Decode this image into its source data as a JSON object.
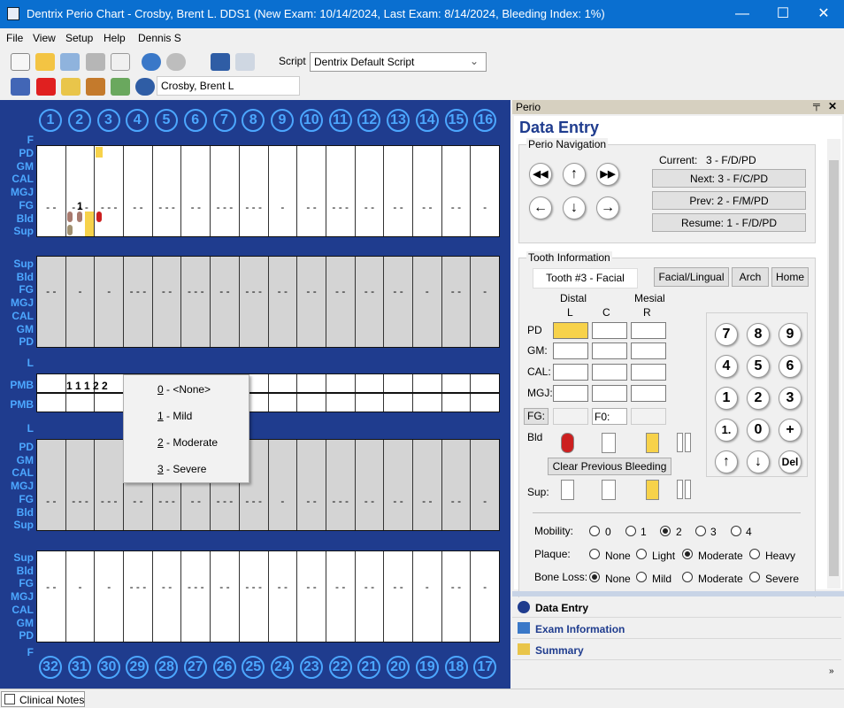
{
  "window": {
    "title": "Dentrix Perio Chart - Crosby, Brent L.  DDS1 (New Exam: 10/14/2024, Last Exam: 8/14/2024, Bleeding Index: 1%)",
    "minimize": "—",
    "maximize": "☐",
    "close": "✕"
  },
  "menu": [
    "File",
    "View",
    "Setup",
    "Help",
    "Dennis S"
  ],
  "toolbar": {
    "script_label": "Script",
    "script_value": "Dentrix Default Script",
    "patient": "Crosby, Brent L"
  },
  "chart": {
    "upper_teeth": [
      "1",
      "2",
      "3",
      "4",
      "5",
      "6",
      "7",
      "8",
      "9",
      "10",
      "11",
      "12",
      "13",
      "14",
      "15",
      "16"
    ],
    "lower_teeth": [
      "32",
      "31",
      "30",
      "29",
      "28",
      "27",
      "26",
      "25",
      "24",
      "23",
      "22",
      "21",
      "20",
      "19",
      "18",
      "17"
    ],
    "F_label": "F",
    "L_label": "L",
    "upper_facial_rows": [
      "PD",
      "GM",
      "CAL",
      "MGJ",
      "FG",
      "Bld",
      "Sup"
    ],
    "upper_lingual_rows": [
      "Sup",
      "Bld",
      "FG",
      "MGJ",
      "CAL",
      "GM",
      "PD"
    ],
    "pmb_label": "PMB",
    "pmb_values": "1 1 1 2 2",
    "fg_value_tooth2": "1",
    "lower_lingual_rows": [
      "PD",
      "GM",
      "CAL",
      "MGJ",
      "FG",
      "Bld",
      "Sup"
    ],
    "lower_facial_rows": [
      "Sup",
      "Bld",
      "FG",
      "MGJ",
      "CAL",
      "GM",
      "PD"
    ],
    "fg_dashes": [
      "- -",
      "- - -",
      "- - -",
      "- -",
      "- - -",
      "- -",
      "- - -",
      "- - -",
      "-",
      "- -",
      "- - -",
      "- -",
      "- -",
      "- -",
      "- -",
      "-"
    ],
    "fg_dashes_upper_lingual": [
      "- -",
      "-",
      "-",
      "- - -",
      "- -",
      "- - -",
      "- -",
      "- - -",
      "- -",
      "- -",
      "- -",
      "- -",
      "- -",
      "-",
      "- -",
      "-"
    ]
  },
  "context_menu": [
    {
      "key": "0",
      "label": " - <None>"
    },
    {
      "key": "1",
      "label": " - Mild"
    },
    {
      "key": "2",
      "label": " - Moderate"
    },
    {
      "key": "3",
      "label": " - Severe"
    }
  ],
  "panel": {
    "header": "Perio",
    "pin": "📌",
    "close": "✕",
    "title": "Data Entry",
    "nav_group": "Perio Navigation",
    "current_label": "Current:",
    "current_value": "3 - F/D/PD",
    "next_btn": "Next:   3 - F/C/PD",
    "prev_btn": "Prev:   2 - F/M/PD",
    "resume_btn": "Resume:  1 - F/D/PD",
    "tooth_group": "Tooth Information",
    "tooth_field": "Tooth #3 - Facial",
    "facial_lingual_btn": "Facial/Lingual",
    "arch_btn": "Arch",
    "home_btn": "Home",
    "distal": "Distal",
    "mesial": "Mesial",
    "col_L": "L",
    "col_C": "C",
    "col_R": "R",
    "pd": "PD",
    "gm": "GM:",
    "cal": "CAL:",
    "mgj": "MGJ:",
    "fg": "FG:",
    "fg_select": "F0:",
    "bld": "Bld",
    "sup": "Sup:",
    "clear_bleeding": "Clear Previous Bleeding",
    "keypad": [
      "7",
      "8",
      "9",
      "4",
      "5",
      "6",
      "1",
      "2",
      "3",
      "1.",
      "0",
      "+",
      "↑",
      "↓",
      "Del"
    ],
    "mobility_label": "Mobility:",
    "mobility_opts": [
      "0",
      "1",
      "2",
      "3",
      "4"
    ],
    "mobility_selected": "2",
    "plaque_label": "Plaque:",
    "plaque_opts": [
      "None",
      "Light",
      "Moderate",
      "Heavy"
    ],
    "plaque_selected": "Moderate",
    "boneloss_label": "Bone Loss:",
    "boneloss_opts": [
      "None",
      "Mild",
      "Moderate",
      "Severe"
    ],
    "boneloss_selected": "None",
    "sections": [
      "Data Entry",
      "Exam Information",
      "Summary"
    ]
  },
  "status": {
    "clinical_notes": "Clinical Notes"
  },
  "colors": {
    "chart_bg": "#1f3c8e",
    "accent_blue": "#4ca7ff",
    "highlight": "#f7d24a",
    "bleed": "#cc1f1f",
    "titlebar": "#0a6fd0",
    "panel_title": "#1f3c8e"
  }
}
